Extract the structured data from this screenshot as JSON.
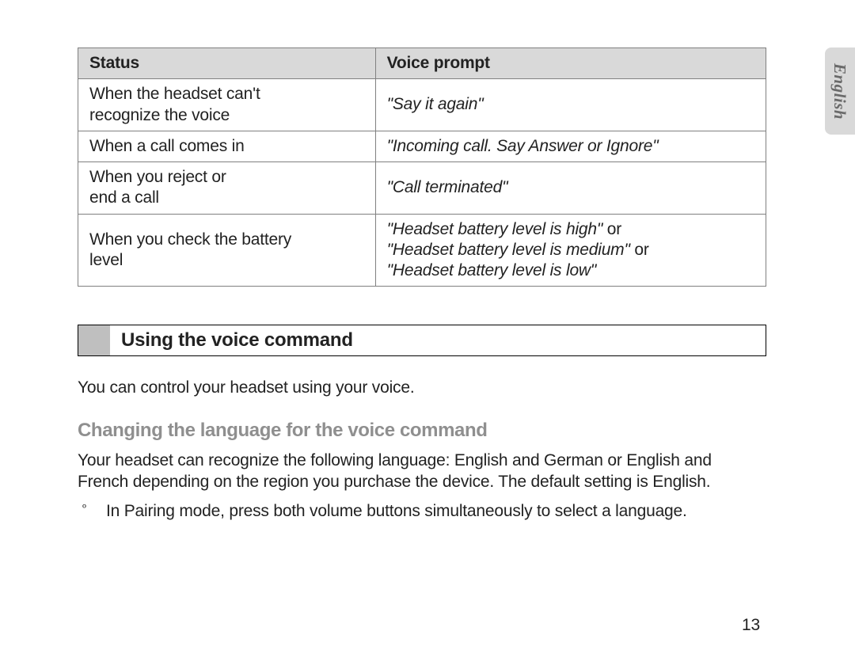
{
  "side_tab": {
    "label": "English"
  },
  "table": {
    "headers": [
      "Status",
      "Voice prompt"
    ],
    "rows": [
      {
        "status_l1": "When the headset can't",
        "status_l2": "recognize the voice",
        "prompt_l1": "\"Say it again\"",
        "prompt_l2": "",
        "prompt_l3": "",
        "suffix_l1": "",
        "suffix_l2": ""
      },
      {
        "status_l1": "When a call comes in",
        "status_l2": "",
        "prompt_l1": "\"Incoming call. Say Answer or Ignore\"",
        "prompt_l2": "",
        "prompt_l3": "",
        "suffix_l1": "",
        "suffix_l2": ""
      },
      {
        "status_l1": "When you reject or",
        "status_l2": "end a call",
        "prompt_l1": "\"Call terminated\"",
        "prompt_l2": "",
        "prompt_l3": "",
        "suffix_l1": "",
        "suffix_l2": ""
      },
      {
        "status_l1": "When you check the battery",
        "status_l2": "level",
        "prompt_l1": "\"Headset battery level is high\"",
        "prompt_l2": "\"Headset battery level is medium\"",
        "prompt_l3": "\"Headset battery level is low\"",
        "suffix_l1": " or",
        "suffix_l2": " or"
      }
    ]
  },
  "section_heading": "Using the voice command",
  "intro_text": "You can control your headset using your voice.",
  "sub_heading": "Changing the language for the voice command",
  "paragraph": "Your headset can recognize the following language: English and German or English and French depending on the region you purchase the device. The default setting is English.",
  "step_marker": "º",
  "step_text": "In Pairing mode, press both volume buttons simultaneously to select a language.",
  "page_number": "13"
}
